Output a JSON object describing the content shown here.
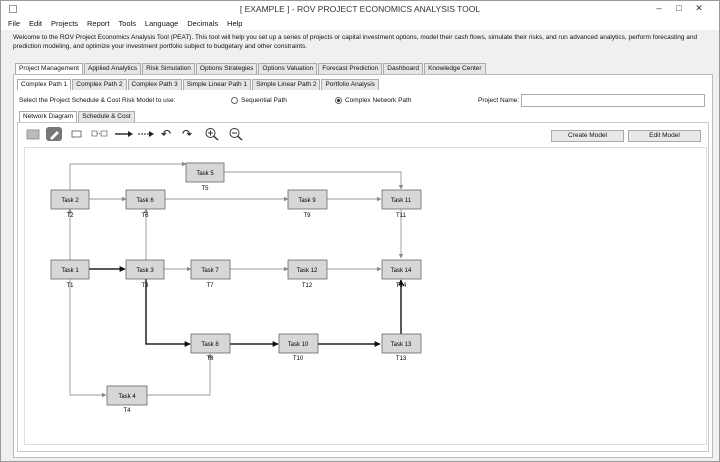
{
  "window": {
    "title": "[ EXAMPLE ] - ROV PROJECT ECONOMICS ANALYSIS TOOL"
  },
  "menu": [
    "File",
    "Edit",
    "Projects",
    "Report",
    "Tools",
    "Language",
    "Decimals",
    "Help"
  ],
  "welcome": "Welcome to the ROV Project Economics Analysis Tool (PEAT). This tool will help you set up a series of projects or capital investment options, model their cash flows, simulate their risks, and run advanced analytics, perform forecasting and prediction modeling, and optimize your investment portfolio subject to budgetary and other constraints.",
  "main_tabs": [
    "Project Management",
    "Applied Analytics",
    "Risk Simulation",
    "Options Strategies",
    "Options Valuation",
    "Forecast Prediction",
    "Dashboard",
    "Knowledge Center"
  ],
  "sub_tabs": [
    "Complex Path 1",
    "Complex Path 2",
    "Complex Path 3",
    "Simple Linear Path 1",
    "Simple Linear Path 2",
    "Portfolio Analysis"
  ],
  "select_label": "Select the Project Schedule & Cost Risk Model to use:",
  "radio": {
    "sequential": "Sequential Path",
    "complex": "Complex Network Path"
  },
  "project_name_label": "Project Name:",
  "project_name_value": "",
  "view_tabs": [
    "Network Diagram",
    "Schedule & Cost"
  ],
  "buttons": {
    "create": "Create Model",
    "edit": "Edit Model"
  },
  "toolbar_icons": [
    "open-icon",
    "edit-pencil-icon",
    "rectangle-icon",
    "dashed-node-icon",
    "arrow-icon",
    "dashed-arrow-icon",
    "undo-icon",
    "redo-icon",
    "zoom-in-icon",
    "zoom-out-icon"
  ],
  "nodes": [
    {
      "label": "Task 1",
      "tag": "T1"
    },
    {
      "label": "Task 2",
      "tag": "T2"
    },
    {
      "label": "Task 3",
      "tag": "T3"
    },
    {
      "label": "Task 4",
      "tag": "T4"
    },
    {
      "label": "Task 5",
      "tag": "T5"
    },
    {
      "label": "Task 6",
      "tag": "T6"
    },
    {
      "label": "Task 7",
      "tag": "T7"
    },
    {
      "label": "Task 8",
      "tag": "T8"
    },
    {
      "label": "Task 9",
      "tag": "T9"
    },
    {
      "label": "Task 10",
      "tag": "T10"
    },
    {
      "label": "Task 11",
      "tag": "T11"
    },
    {
      "label": "Task 12",
      "tag": "T12"
    },
    {
      "label": "Task 13",
      "tag": "T13"
    },
    {
      "label": "Task 14",
      "tag": "T14"
    }
  ]
}
